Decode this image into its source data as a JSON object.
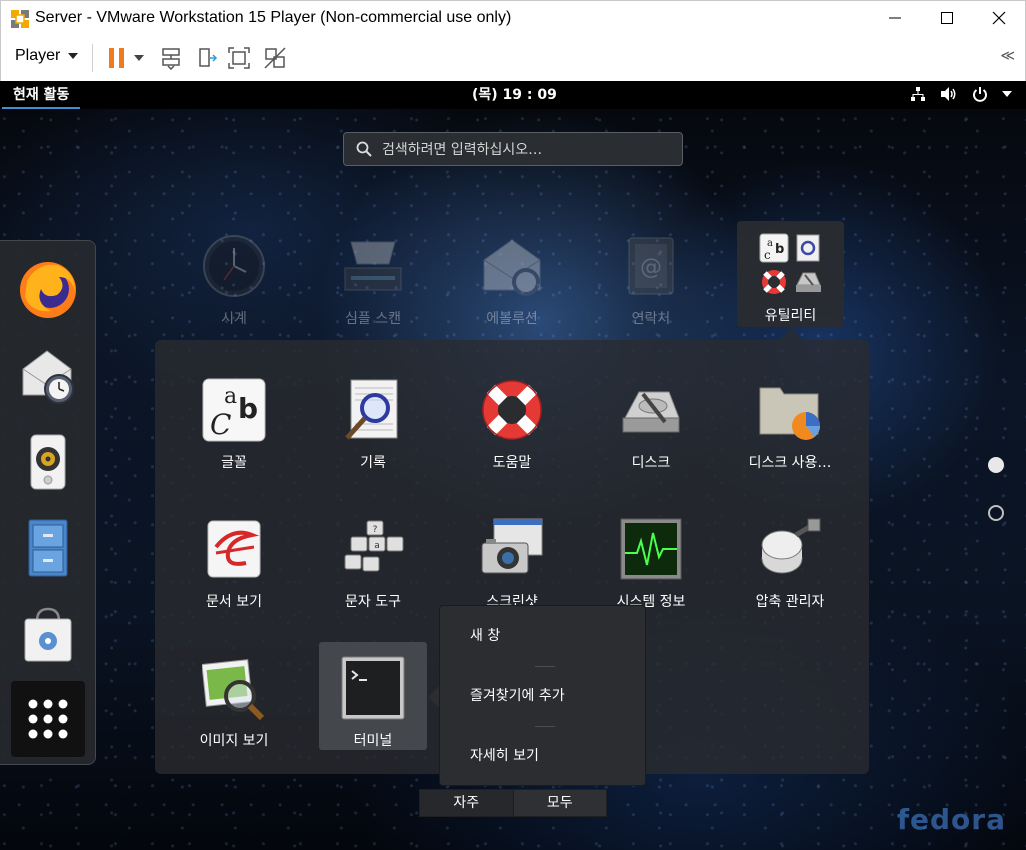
{
  "window": {
    "title": "Server - VMware Workstation 15 Player (Non-commercial use only)"
  },
  "toolbar": {
    "player_label": "Player",
    "collapse_glyph": "≪"
  },
  "topbar": {
    "activities": "현재 활동",
    "clock": "(목) 19 : 09"
  },
  "search": {
    "placeholder": "검색하려면 입력하십시오…"
  },
  "faded_apps": [
    {
      "label": "시계",
      "icon": "clock-icon"
    },
    {
      "label": "심플 스캔",
      "icon": "scanner-icon"
    },
    {
      "label": "에볼루션",
      "icon": "evolution-mail-icon"
    },
    {
      "label": "연락처",
      "icon": "contacts-icon"
    }
  ],
  "utility_folder": {
    "label": "유틸리티"
  },
  "folder_apps": [
    {
      "label": "글꼴",
      "icon": "fonts-icon"
    },
    {
      "label": "기록",
      "icon": "logs-icon"
    },
    {
      "label": "도움말",
      "icon": "help-lifebuoy-icon"
    },
    {
      "label": "디스크",
      "icon": "disks-icon"
    },
    {
      "label": "디스크 사용…",
      "icon": "disk-usage-icon"
    },
    {
      "label": "문서 보기",
      "icon": "document-viewer-icon"
    },
    {
      "label": "문자 도구",
      "icon": "characters-icon"
    },
    {
      "label": "스크린샷",
      "icon": "screenshot-camera-icon"
    },
    {
      "label": "시스템 정보",
      "icon": "system-monitor-icon"
    },
    {
      "label": "압축 관리자",
      "icon": "archive-manager-icon"
    },
    {
      "label": "이미지 보기",
      "icon": "image-viewer-icon"
    },
    {
      "label": "터미널",
      "icon": "terminal-icon"
    }
  ],
  "context_menu": {
    "items": [
      "새 창",
      "즐겨찾기에 추가",
      "자세히 보기"
    ]
  },
  "view_tabs": [
    "자주",
    "모두"
  ],
  "dash": [
    {
      "icon": "firefox-icon"
    },
    {
      "icon": "evolution-mail-icon"
    },
    {
      "icon": "rhythmbox-speaker-icon"
    },
    {
      "icon": "files-cabinet-icon"
    },
    {
      "icon": "software-bag-icon"
    },
    {
      "icon": "show-applications-icon"
    }
  ],
  "branding": {
    "fedora": "fedora"
  },
  "colors": {
    "accent_blue": "#3d8fd6",
    "pause_orange": "#f07a1e",
    "topbar_bg": "#000000",
    "menu_bg": "#2b2d30"
  }
}
